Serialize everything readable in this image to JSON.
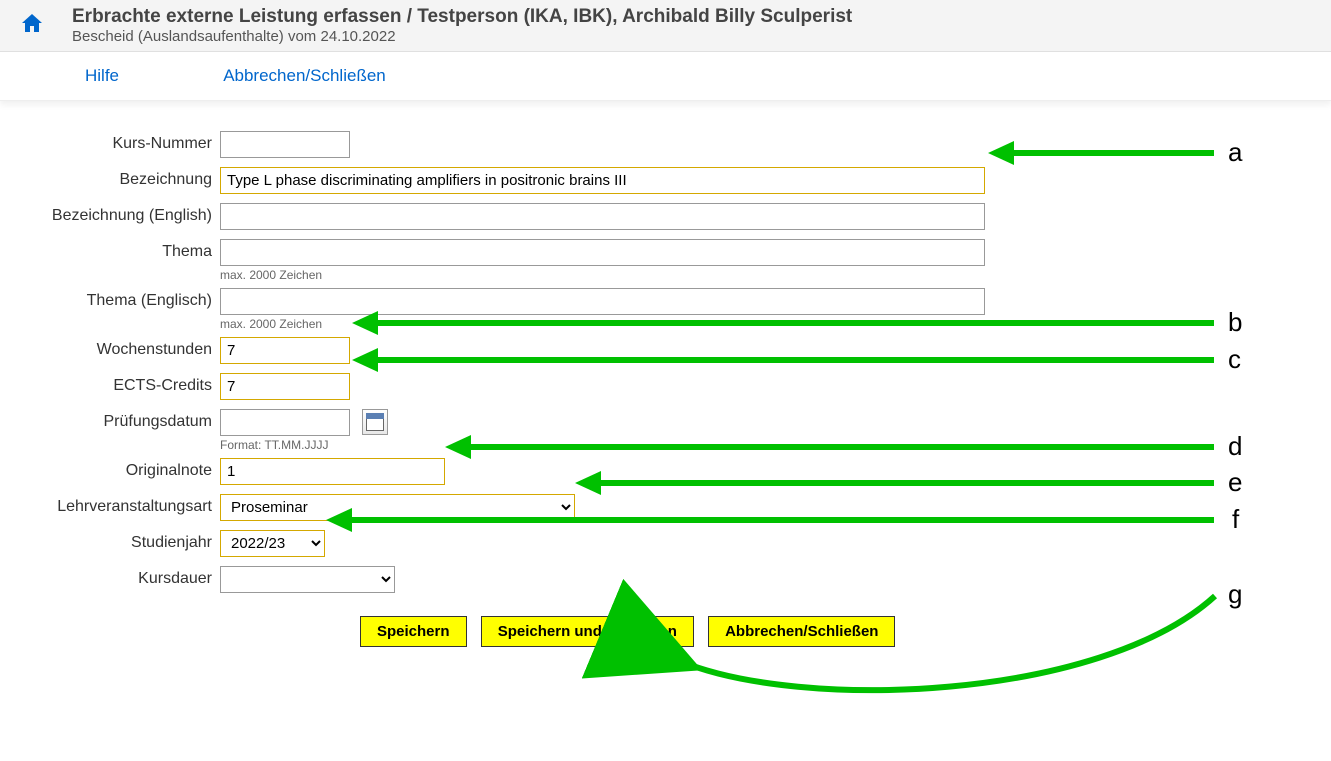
{
  "header": {
    "title": "Erbrachte externe Leistung erfassen  / Testperson (IKA, IBK), Archibald Billy Sculperist",
    "subtitle": "Bescheid (Auslandsaufenthalte) vom 24.10.2022"
  },
  "linkbar": {
    "help": "Hilfe",
    "cancel": "Abbrechen/Schließen"
  },
  "form": {
    "kurs_nummer": {
      "label": "Kurs-Nummer",
      "value": ""
    },
    "bezeichnung": {
      "label": "Bezeichnung",
      "value": "Type L phase discriminating amplifiers in positronic brains III"
    },
    "bezeichnung_en": {
      "label": "Bezeichnung (English)",
      "value": ""
    },
    "thema": {
      "label": "Thema",
      "value": "",
      "hint": "max. 2000 Zeichen"
    },
    "thema_en": {
      "label": "Thema (Englisch)",
      "value": "",
      "hint": "max. 2000 Zeichen"
    },
    "wochenstunden": {
      "label": "Wochenstunden",
      "value": "7"
    },
    "ects": {
      "label": "ECTS-Credits",
      "value": "7"
    },
    "pruefungsdatum": {
      "label": "Prüfungsdatum",
      "value": "",
      "hint": "Format: TT.MM.JJJJ"
    },
    "originalnote": {
      "label": "Originalnote",
      "value": "1"
    },
    "lv_art": {
      "label": "Lehrveranstaltungsart",
      "value": "Proseminar"
    },
    "studienjahr": {
      "label": "Studienjahr",
      "value": "2022/23"
    },
    "kursdauer": {
      "label": "Kursdauer",
      "value": ""
    }
  },
  "buttons": {
    "save": "Speichern",
    "save_close": "Speichern und Schließen",
    "cancel": "Abbrechen/Schließen"
  },
  "annotations": {
    "a": "a",
    "b": "b",
    "c": "c",
    "d": "d",
    "e": "e",
    "f": "f",
    "g": "g"
  }
}
